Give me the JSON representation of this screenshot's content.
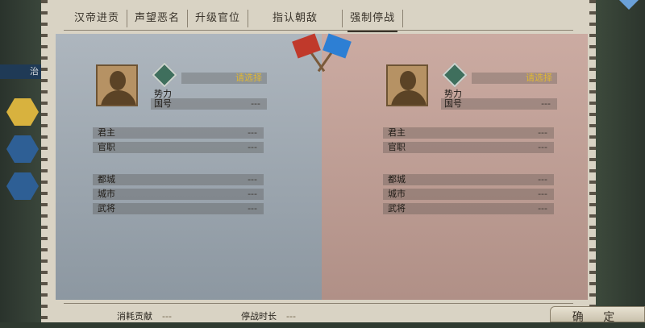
{
  "tabs": [
    "汉帝进贡",
    "声望恶名",
    "升级官位",
    "指认朝敌",
    "强制停战"
  ],
  "active_tab": "强制停战",
  "left_hud_label": "治",
  "confirm_label": "确 定",
  "left_side": {
    "power_label": "势力",
    "select_label": "请选择",
    "rows": {
      "country": {
        "label": "国号",
        "value": "---"
      },
      "lord": {
        "label": "君主",
        "value": "---"
      },
      "rank": {
        "label": "官职",
        "value": "---"
      },
      "capital": {
        "label": "都城",
        "value": "---"
      },
      "cities": {
        "label": "城市",
        "value": "---"
      },
      "generals": {
        "label": "武将",
        "value": "---"
      }
    }
  },
  "right_side": {
    "power_label": "势力",
    "select_label": "请选择",
    "rows": {
      "country": {
        "label": "国号",
        "value": "---"
      },
      "lord": {
        "label": "君主",
        "value": "---"
      },
      "rank": {
        "label": "官职",
        "value": "---"
      },
      "capital": {
        "label": "都城",
        "value": "---"
      },
      "cities": {
        "label": "城市",
        "value": "---"
      },
      "generals": {
        "label": "武将",
        "value": "---"
      }
    }
  },
  "bottom": {
    "cost_label": "消耗贡献",
    "cost_value": "---",
    "duration_label": "停战时长",
    "duration_value": "---"
  },
  "colors": {
    "red_team": "#c0392b",
    "blue_team": "#2d7fd4",
    "select_text": "#e0b834"
  }
}
